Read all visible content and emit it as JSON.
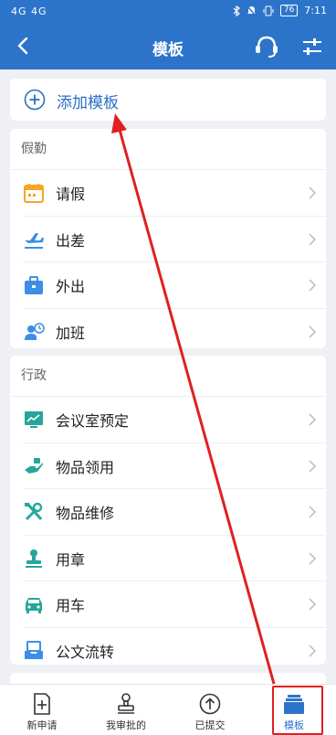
{
  "status_bar": {
    "signal": "4G 4G",
    "battery": "76",
    "time": "7:11"
  },
  "header": {
    "title": "模板"
  },
  "add_template": {
    "label": "添加模板"
  },
  "sections": [
    {
      "title": "假勤",
      "items": [
        {
          "label": "请假",
          "icon": "calendar-icon",
          "color": "#f5a623"
        },
        {
          "label": "出差",
          "icon": "airplane-icon",
          "color": "#3d8ee6"
        },
        {
          "label": "外出",
          "icon": "briefcase-icon",
          "color": "#3d8ee6"
        },
        {
          "label": "加班",
          "icon": "person-clock-icon",
          "color": "#3d8ee6"
        }
      ]
    },
    {
      "title": "行政",
      "items": [
        {
          "label": "会议室预定",
          "icon": "presentation-icon",
          "color": "#26a69a"
        },
        {
          "label": "物品领用",
          "icon": "hand-icon",
          "color": "#26a69a"
        },
        {
          "label": "物品维修",
          "icon": "tools-icon",
          "color": "#26a69a"
        },
        {
          "label": "用章",
          "icon": "stamp-icon",
          "color": "#26a69a"
        },
        {
          "label": "用车",
          "icon": "car-icon",
          "color": "#26a69a"
        },
        {
          "label": "公文流转",
          "icon": "inbox-icon",
          "color": "#3d8ee6"
        }
      ]
    }
  ],
  "tabs": [
    {
      "label": "新申请",
      "icon": "new-application-icon"
    },
    {
      "label": "我审批的",
      "icon": "stamp-icon"
    },
    {
      "label": "已提交",
      "icon": "upload-icon"
    },
    {
      "label": "模板",
      "icon": "template-stack-icon",
      "active": true
    }
  ],
  "colors": {
    "primary": "#2c74c9",
    "annotation": "#e02020"
  }
}
